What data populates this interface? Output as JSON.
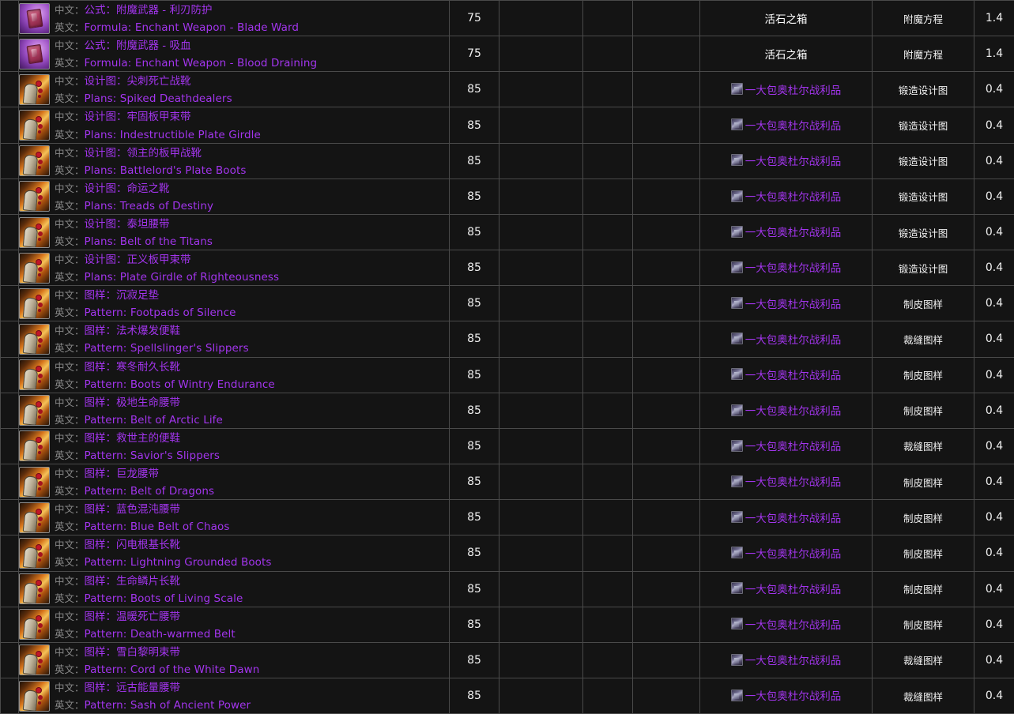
{
  "colors": {
    "background": "#141414",
    "border": "#4a4a4a",
    "epic_purple": "#a335ee",
    "label_gray": "#8a8a8a",
    "value_white": "#f0f0f0"
  },
  "labels": {
    "zh_prefix": "中文：",
    "en_prefix": "英文："
  },
  "table": {
    "rows": [
      {
        "icon": "enchant-scroll-icon",
        "name_zh": "公式：附魔武器 - 利刃防护",
        "name_en": "Formula: Enchant Weapon - Blade Ward",
        "level": "75",
        "col_e1": "",
        "col_e2": "",
        "col_e3": "",
        "drop": "活石之箱",
        "drop_has_icon": false,
        "drop_is_link": false,
        "type": "附魔方程",
        "value": "1.4"
      },
      {
        "icon": "enchant-scroll-icon",
        "name_zh": "公式：附魔武器 - 吸血",
        "name_en": "Formula: Enchant Weapon - Blood Draining",
        "level": "75",
        "col_e1": "",
        "col_e2": "",
        "col_e3": "",
        "drop": "活石之箱",
        "drop_has_icon": false,
        "drop_is_link": false,
        "type": "附魔方程",
        "value": "1.4"
      },
      {
        "icon": "plans-scroll-icon",
        "name_zh": "设计图：尖刺死亡战靴",
        "name_en": "Plans: Spiked Deathdealers",
        "level": "85",
        "col_e1": "",
        "col_e2": "",
        "col_e3": "",
        "drop": "一大包奥杜尔战利品",
        "drop_has_icon": true,
        "drop_is_link": true,
        "type": "锻造设计图",
        "value": "0.4"
      },
      {
        "icon": "plans-scroll-icon",
        "name_zh": "设计图：牢固板甲束带",
        "name_en": "Plans: Indestructible Plate Girdle",
        "level": "85",
        "col_e1": "",
        "col_e2": "",
        "col_e3": "",
        "drop": "一大包奥杜尔战利品",
        "drop_has_icon": true,
        "drop_is_link": true,
        "type": "锻造设计图",
        "value": "0.4"
      },
      {
        "icon": "plans-scroll-icon",
        "name_zh": "设计图：领主的板甲战靴",
        "name_en": "Plans: Battlelord's Plate Boots",
        "level": "85",
        "col_e1": "",
        "col_e2": "",
        "col_e3": "",
        "drop": "一大包奥杜尔战利品",
        "drop_has_icon": true,
        "drop_is_link": true,
        "type": "锻造设计图",
        "value": "0.4"
      },
      {
        "icon": "plans-scroll-icon",
        "name_zh": "设计图：命运之靴",
        "name_en": "Plans: Treads of Destiny",
        "level": "85",
        "col_e1": "",
        "col_e2": "",
        "col_e3": "",
        "drop": "一大包奥杜尔战利品",
        "drop_has_icon": true,
        "drop_is_link": true,
        "type": "锻造设计图",
        "value": "0.4"
      },
      {
        "icon": "plans-scroll-icon",
        "name_zh": "设计图：泰坦腰带",
        "name_en": "Plans: Belt of the Titans",
        "level": "85",
        "col_e1": "",
        "col_e2": "",
        "col_e3": "",
        "drop": "一大包奥杜尔战利品",
        "drop_has_icon": true,
        "drop_is_link": true,
        "type": "锻造设计图",
        "value": "0.4"
      },
      {
        "icon": "plans-scroll-icon",
        "name_zh": "设计图：正义板甲束带",
        "name_en": "Plans: Plate Girdle of Righteousness",
        "level": "85",
        "col_e1": "",
        "col_e2": "",
        "col_e3": "",
        "drop": "一大包奥杜尔战利品",
        "drop_has_icon": true,
        "drop_is_link": true,
        "type": "锻造设计图",
        "value": "0.4"
      },
      {
        "icon": "plans-scroll-icon",
        "name_zh": "图样：沉寂足垫",
        "name_en": "Pattern: Footpads of Silence",
        "level": "85",
        "col_e1": "",
        "col_e2": "",
        "col_e3": "",
        "drop": "一大包奥杜尔战利品",
        "drop_has_icon": true,
        "drop_is_link": true,
        "type": "制皮图样",
        "value": "0.4"
      },
      {
        "icon": "plans-scroll-icon",
        "name_zh": "图样：法术爆发便鞋",
        "name_en": "Pattern: Spellslinger's Slippers",
        "level": "85",
        "col_e1": "",
        "col_e2": "",
        "col_e3": "",
        "drop": "一大包奥杜尔战利品",
        "drop_has_icon": true,
        "drop_is_link": true,
        "type": "裁缝图样",
        "value": "0.4"
      },
      {
        "icon": "plans-scroll-icon",
        "name_zh": "图样：寒冬耐久长靴",
        "name_en": "Pattern: Boots of Wintry Endurance",
        "level": "85",
        "col_e1": "",
        "col_e2": "",
        "col_e3": "",
        "drop": "一大包奥杜尔战利品",
        "drop_has_icon": true,
        "drop_is_link": true,
        "type": "制皮图样",
        "value": "0.4"
      },
      {
        "icon": "plans-scroll-icon",
        "name_zh": "图样：极地生命腰带",
        "name_en": "Pattern: Belt of Arctic Life",
        "level": "85",
        "col_e1": "",
        "col_e2": "",
        "col_e3": "",
        "drop": "一大包奥杜尔战利品",
        "drop_has_icon": true,
        "drop_is_link": true,
        "type": "制皮图样",
        "value": "0.4"
      },
      {
        "icon": "plans-scroll-icon",
        "name_zh": "图样：救世主的便鞋",
        "name_en": "Pattern: Savior's Slippers",
        "level": "85",
        "col_e1": "",
        "col_e2": "",
        "col_e3": "",
        "drop": "一大包奥杜尔战利品",
        "drop_has_icon": true,
        "drop_is_link": true,
        "type": "裁缝图样",
        "value": "0.4"
      },
      {
        "icon": "plans-scroll-icon",
        "name_zh": "图样：巨龙腰带",
        "name_en": "Pattern: Belt of Dragons",
        "level": "85",
        "col_e1": "",
        "col_e2": "",
        "col_e3": "",
        "drop": "一大包奥杜尔战利品",
        "drop_has_icon": true,
        "drop_is_link": true,
        "type": "制皮图样",
        "value": "0.4"
      },
      {
        "icon": "plans-scroll-icon",
        "name_zh": "图样：蓝色混沌腰带",
        "name_en": "Pattern: Blue Belt of Chaos",
        "level": "85",
        "col_e1": "",
        "col_e2": "",
        "col_e3": "",
        "drop": "一大包奥杜尔战利品",
        "drop_has_icon": true,
        "drop_is_link": true,
        "type": "制皮图样",
        "value": "0.4"
      },
      {
        "icon": "plans-scroll-icon",
        "name_zh": "图样：闪电根基长靴",
        "name_en": "Pattern: Lightning Grounded Boots",
        "level": "85",
        "col_e1": "",
        "col_e2": "",
        "col_e3": "",
        "drop": "一大包奥杜尔战利品",
        "drop_has_icon": true,
        "drop_is_link": true,
        "type": "制皮图样",
        "value": "0.4"
      },
      {
        "icon": "plans-scroll-icon",
        "name_zh": "图样：生命鳞片长靴",
        "name_en": "Pattern: Boots of Living Scale",
        "level": "85",
        "col_e1": "",
        "col_e2": "",
        "col_e3": "",
        "drop": "一大包奥杜尔战利品",
        "drop_has_icon": true,
        "drop_is_link": true,
        "type": "制皮图样",
        "value": "0.4"
      },
      {
        "icon": "plans-scroll-icon",
        "name_zh": "图样：温暖死亡腰带",
        "name_en": "Pattern: Death-warmed Belt",
        "level": "85",
        "col_e1": "",
        "col_e2": "",
        "col_e3": "",
        "drop": "一大包奥杜尔战利品",
        "drop_has_icon": true,
        "drop_is_link": true,
        "type": "制皮图样",
        "value": "0.4"
      },
      {
        "icon": "plans-scroll-icon",
        "name_zh": "图样：雪白黎明束带",
        "name_en": "Pattern: Cord of the White Dawn",
        "level": "85",
        "col_e1": "",
        "col_e2": "",
        "col_e3": "",
        "drop": "一大包奥杜尔战利品",
        "drop_has_icon": true,
        "drop_is_link": true,
        "type": "裁缝图样",
        "value": "0.4"
      },
      {
        "icon": "plans-scroll-icon",
        "name_zh": "图样：远古能量腰带",
        "name_en": "Pattern: Sash of Ancient Power",
        "level": "85",
        "col_e1": "",
        "col_e2": "",
        "col_e3": "",
        "drop": "一大包奥杜尔战利品",
        "drop_has_icon": true,
        "drop_is_link": true,
        "type": "裁缝图样",
        "value": "0.4"
      }
    ]
  }
}
